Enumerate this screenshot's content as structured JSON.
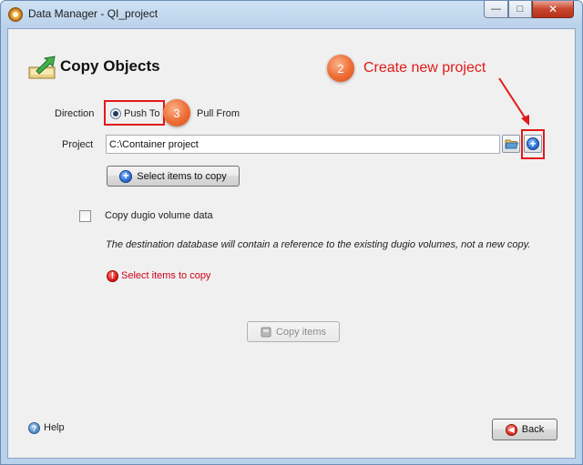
{
  "window": {
    "title": "Data Manager - QI_project",
    "controls": {
      "minimize": "—",
      "maximize": "□",
      "close": "✕"
    }
  },
  "header": {
    "title": "Copy Objects",
    "icon": "copy-objects-icon"
  },
  "direction": {
    "label": "Direction",
    "options": [
      {
        "label": "Push To",
        "selected": true
      },
      {
        "label": "Pull From",
        "selected": false
      }
    ]
  },
  "project": {
    "label": "Project",
    "value": "C:\\Container project",
    "browse_icon": "folder-open-icon",
    "new_icon": "plus-circle-icon"
  },
  "select_items_button": {
    "label": "Select items to copy",
    "icon": "plus-circle-icon"
  },
  "dugio": {
    "checkbox_label": "Copy dugio volume data",
    "checked": false,
    "note": "The destination database will contain a reference to the existing dugio volumes, not a new copy."
  },
  "validation": {
    "message": "Select items to copy",
    "icon": "error-icon"
  },
  "copy_button": {
    "label": "Copy items",
    "icon": "copy-icon",
    "enabled": false
  },
  "footer": {
    "help_label": "Help",
    "back_label": "Back"
  },
  "annotations": {
    "badge_2": "2",
    "badge_3": "3",
    "create_new_project": "Create new project",
    "color": "#e21a1a"
  }
}
